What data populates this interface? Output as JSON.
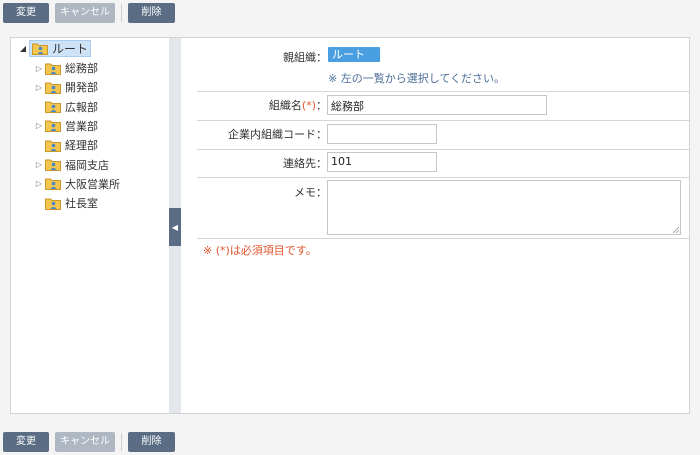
{
  "toolbar": {
    "change_label": "変更",
    "cancel_label": "キャンセル",
    "delete_label": "削除"
  },
  "tree": {
    "root_label": "ルート",
    "items": [
      {
        "label": "総務部",
        "has_children": true
      },
      {
        "label": "開発部",
        "has_children": true
      },
      {
        "label": "広報部",
        "has_children": false
      },
      {
        "label": "営業部",
        "has_children": true
      },
      {
        "label": "経理部",
        "has_children": false
      },
      {
        "label": "福岡支店",
        "has_children": true
      },
      {
        "label": "大阪営業所",
        "has_children": true
      },
      {
        "label": "社長室",
        "has_children": false
      }
    ]
  },
  "form": {
    "parent_label": "親組織：",
    "parent_value": "ルート",
    "parent_hint": "※ 左の一覧から選択してください。",
    "name_label": "組織名",
    "required_mark": "(*)",
    "colon": "：",
    "name_value": "総務部",
    "code_label": "企業内組織コード：",
    "code_value": "",
    "contact_label": "連絡先：",
    "contact_value": "101",
    "memo_label": "メモ：",
    "memo_value": "",
    "required_note": "※ (*)は必須項目です。"
  },
  "colors": {
    "button": "#5a6d84",
    "button_disabled": "#aeb7c2",
    "accent": "#4a9fe0",
    "required": "#e0562e",
    "hint": "#4d6f99"
  }
}
